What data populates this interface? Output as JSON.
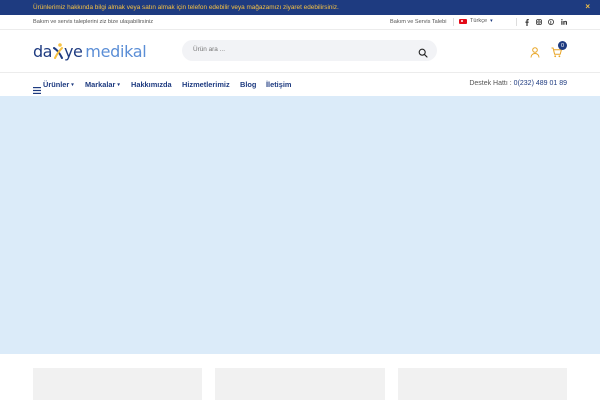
{
  "announcement": {
    "text": "Ürünlerimiz hakkında bilgi almak veya satın almak için telefon edebilir veya mağazamızı ziyaret edebilirsiniz.",
    "close": "×"
  },
  "topbar": {
    "left_text": "Bakım ve servis taleplerini ziz bize ulaşabilirsiniz",
    "service_link": "Bakım ve Servis Talebi",
    "language": "Türkçe",
    "social_icons": [
      "facebook-icon",
      "instagram-icon",
      "pinterest-icon",
      "linkedin-icon"
    ]
  },
  "logo": {
    "part1": "da",
    "part2": "ye",
    "part3": "medikal"
  },
  "search": {
    "placeholder": "Ürün ara ..."
  },
  "cart": {
    "count": "0"
  },
  "nav": {
    "items": [
      {
        "label": "Ürünler",
        "dropdown": true
      },
      {
        "label": "Markalar",
        "dropdown": true
      },
      {
        "label": "Hakkımızda",
        "dropdown": false
      },
      {
        "label": "Hizmetlerimiz",
        "dropdown": false
      },
      {
        "label": "Blog",
        "dropdown": false
      },
      {
        "label": "İletişim",
        "dropdown": false
      }
    ],
    "support_label": "Destek Hattı :",
    "support_phone": "0(232) 489 01 89"
  },
  "colors": {
    "brand_navy": "#1e3b80",
    "brand_light_blue": "#5b8ed6",
    "accent_yellow": "#f6c244",
    "banner_bg": "#dbebf9"
  }
}
